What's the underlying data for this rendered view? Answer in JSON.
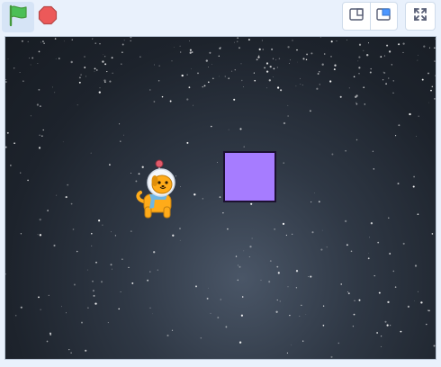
{
  "toolbar": {
    "green_flag": {
      "icon": "green-flag-icon",
      "color": "#4cbf56",
      "active_bg": "#d6e4f6"
    },
    "stop": {
      "icon": "stop-icon",
      "color": "#ec5959"
    },
    "layout": {
      "small_stage": {
        "icon": "small-stage-icon"
      },
      "normal_stage": {
        "icon": "normal-stage-icon",
        "accent": "#4c97ff"
      }
    },
    "fullscreen": {
      "icon": "fullscreen-icon"
    }
  },
  "stage": {
    "backdrop": "space-stars",
    "sprites": [
      {
        "name": "dog-astronaut",
        "color": "#ffab19"
      },
      {
        "name": "purple-square",
        "color": "#a67cff"
      }
    ]
  }
}
